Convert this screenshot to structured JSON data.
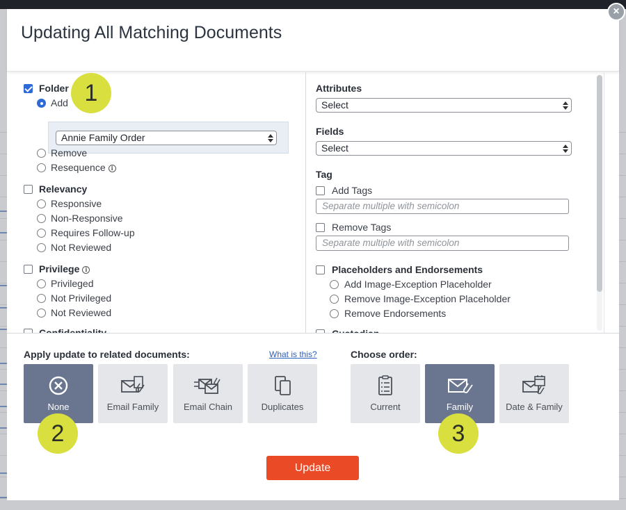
{
  "dialog": {
    "title": "Updating All Matching Documents",
    "close": "×"
  },
  "left": {
    "folder": {
      "label": "Folder",
      "checked": true,
      "options": [
        {
          "label": "Add",
          "selected": true
        },
        {
          "label": "Remove",
          "selected": false
        },
        {
          "label": "Resequence",
          "selected": false
        }
      ],
      "folder_select_value": "Annie Family Order"
    },
    "relevancy": {
      "label": "Relevancy",
      "options": [
        "Responsive",
        "Non-Responsive",
        "Requires Follow-up",
        "Not Reviewed"
      ]
    },
    "privilege": {
      "label": "Privilege",
      "options": [
        "Privileged",
        "Not Privileged",
        "Not Reviewed"
      ]
    },
    "confidentiality_label": "Confidentiality"
  },
  "right": {
    "attributes": {
      "label": "Attributes",
      "value": "Select"
    },
    "fields": {
      "label": "Fields",
      "value": "Select"
    },
    "tag": {
      "label": "Tag",
      "add_label": "Add Tags",
      "add_placeholder": "Separate multiple with semicolon",
      "remove_label": "Remove Tags",
      "remove_placeholder": "Separate multiple with semicolon"
    },
    "placeholders": {
      "label": "Placeholders and Endorsements",
      "options": [
        "Add Image-Exception Placeholder",
        "Remove Image-Exception Placeholder",
        "Remove Endorsements"
      ]
    },
    "custodian_label": "Custodian"
  },
  "footer": {
    "related_label": "Apply update to related documents:",
    "what_link": "What is this?",
    "related_options": [
      {
        "label": "None",
        "icon": "circle-x-icon",
        "active": true
      },
      {
        "label": "Email Family",
        "icon": "email-family-icon",
        "active": false
      },
      {
        "label": "Email Chain",
        "icon": "email-chain-icon",
        "active": false
      },
      {
        "label": "Duplicates",
        "icon": "duplicates-icon",
        "active": false
      }
    ],
    "order_label": "Choose order:",
    "order_options": [
      {
        "label": "Current",
        "icon": "clipboard-list-icon",
        "active": false
      },
      {
        "label": "Family",
        "icon": "email-family-icon",
        "active": true
      },
      {
        "label": "Date & Family",
        "icon": "email-calendar-icon",
        "active": false
      }
    ],
    "update_label": "Update"
  },
  "callouts": [
    "1",
    "2",
    "3"
  ],
  "colors": {
    "accent_blue": "#2d6ad6",
    "active_button": "#6a7690",
    "update_button": "#ea4b26",
    "callout": "#d9df3e"
  }
}
